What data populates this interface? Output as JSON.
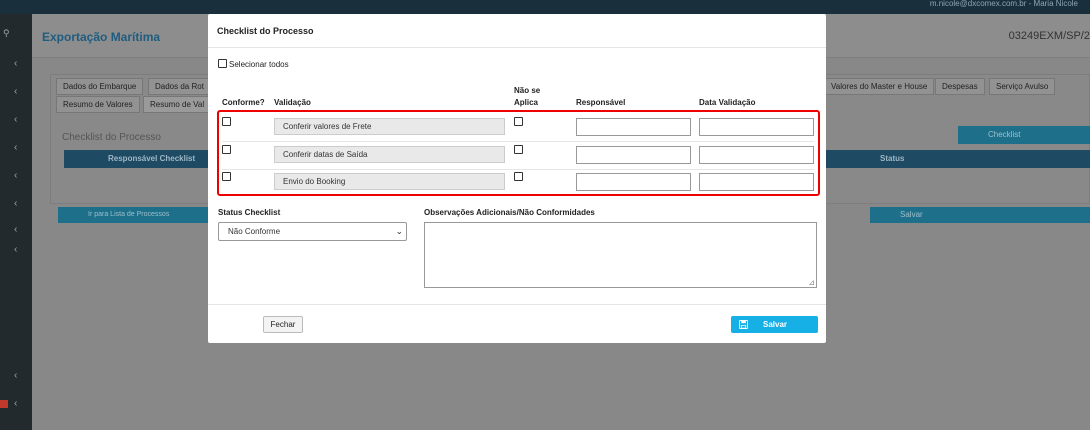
{
  "top_bar": {
    "user_text": "m.nicole@dxcomex.com.br - Maria Nicole"
  },
  "sidebar": {
    "icons": [
      "search-icon",
      "chevron-left-icon"
    ]
  },
  "app": {
    "title": "Exportação Marítima",
    "process_code": "03249EXM/SP/2",
    "tabs": [
      "Dados do Embarque",
      "Dados da Rot",
      "Valores do Master e House",
      "Despesas",
      "Serviço Avulso",
      "Resumo de Valores",
      "Resumo de Val"
    ],
    "section_title": "Checklist do Processo",
    "table_headers": [
      "Responsável Checklist",
      "Status"
    ],
    "checklist_button": "Checklist",
    "back_button": "Ir para Lista de Processos",
    "save_button": "Salvar"
  },
  "modal": {
    "title": "Checklist do Processo",
    "select_all_label": "Selecionar todos",
    "columns": {
      "conforme": "Conforme?",
      "validacao": "Validação",
      "nao_se_aplica_line1": "Não se",
      "nao_se_aplica_line2": "Aplica",
      "responsavel": "Responsável",
      "data_validacao": "Data Validação"
    },
    "rows": [
      {
        "validacao": "Conferir valores de Frete",
        "conforme": false,
        "nao_se_aplica": false,
        "responsavel": "",
        "data_validacao": ""
      },
      {
        "validacao": "Conferir datas de Saída",
        "conforme": false,
        "nao_se_aplica": false,
        "responsavel": "",
        "data_validacao": ""
      },
      {
        "validacao": "Envio do Booking",
        "conforme": false,
        "nao_se_aplica": false,
        "responsavel": "",
        "data_validacao": ""
      }
    ],
    "status_label": "Status Checklist",
    "status_value": "Não Conforme",
    "observacoes_label": "Observações Adicionais/Não Conformidades",
    "observacoes_value": "",
    "fechar_button": "Fechar",
    "salvar_button": "Salvar"
  },
  "colors": {
    "accent": "#17b0e6",
    "highlight_border": "#e00000",
    "app_title": "#1f5d80"
  }
}
